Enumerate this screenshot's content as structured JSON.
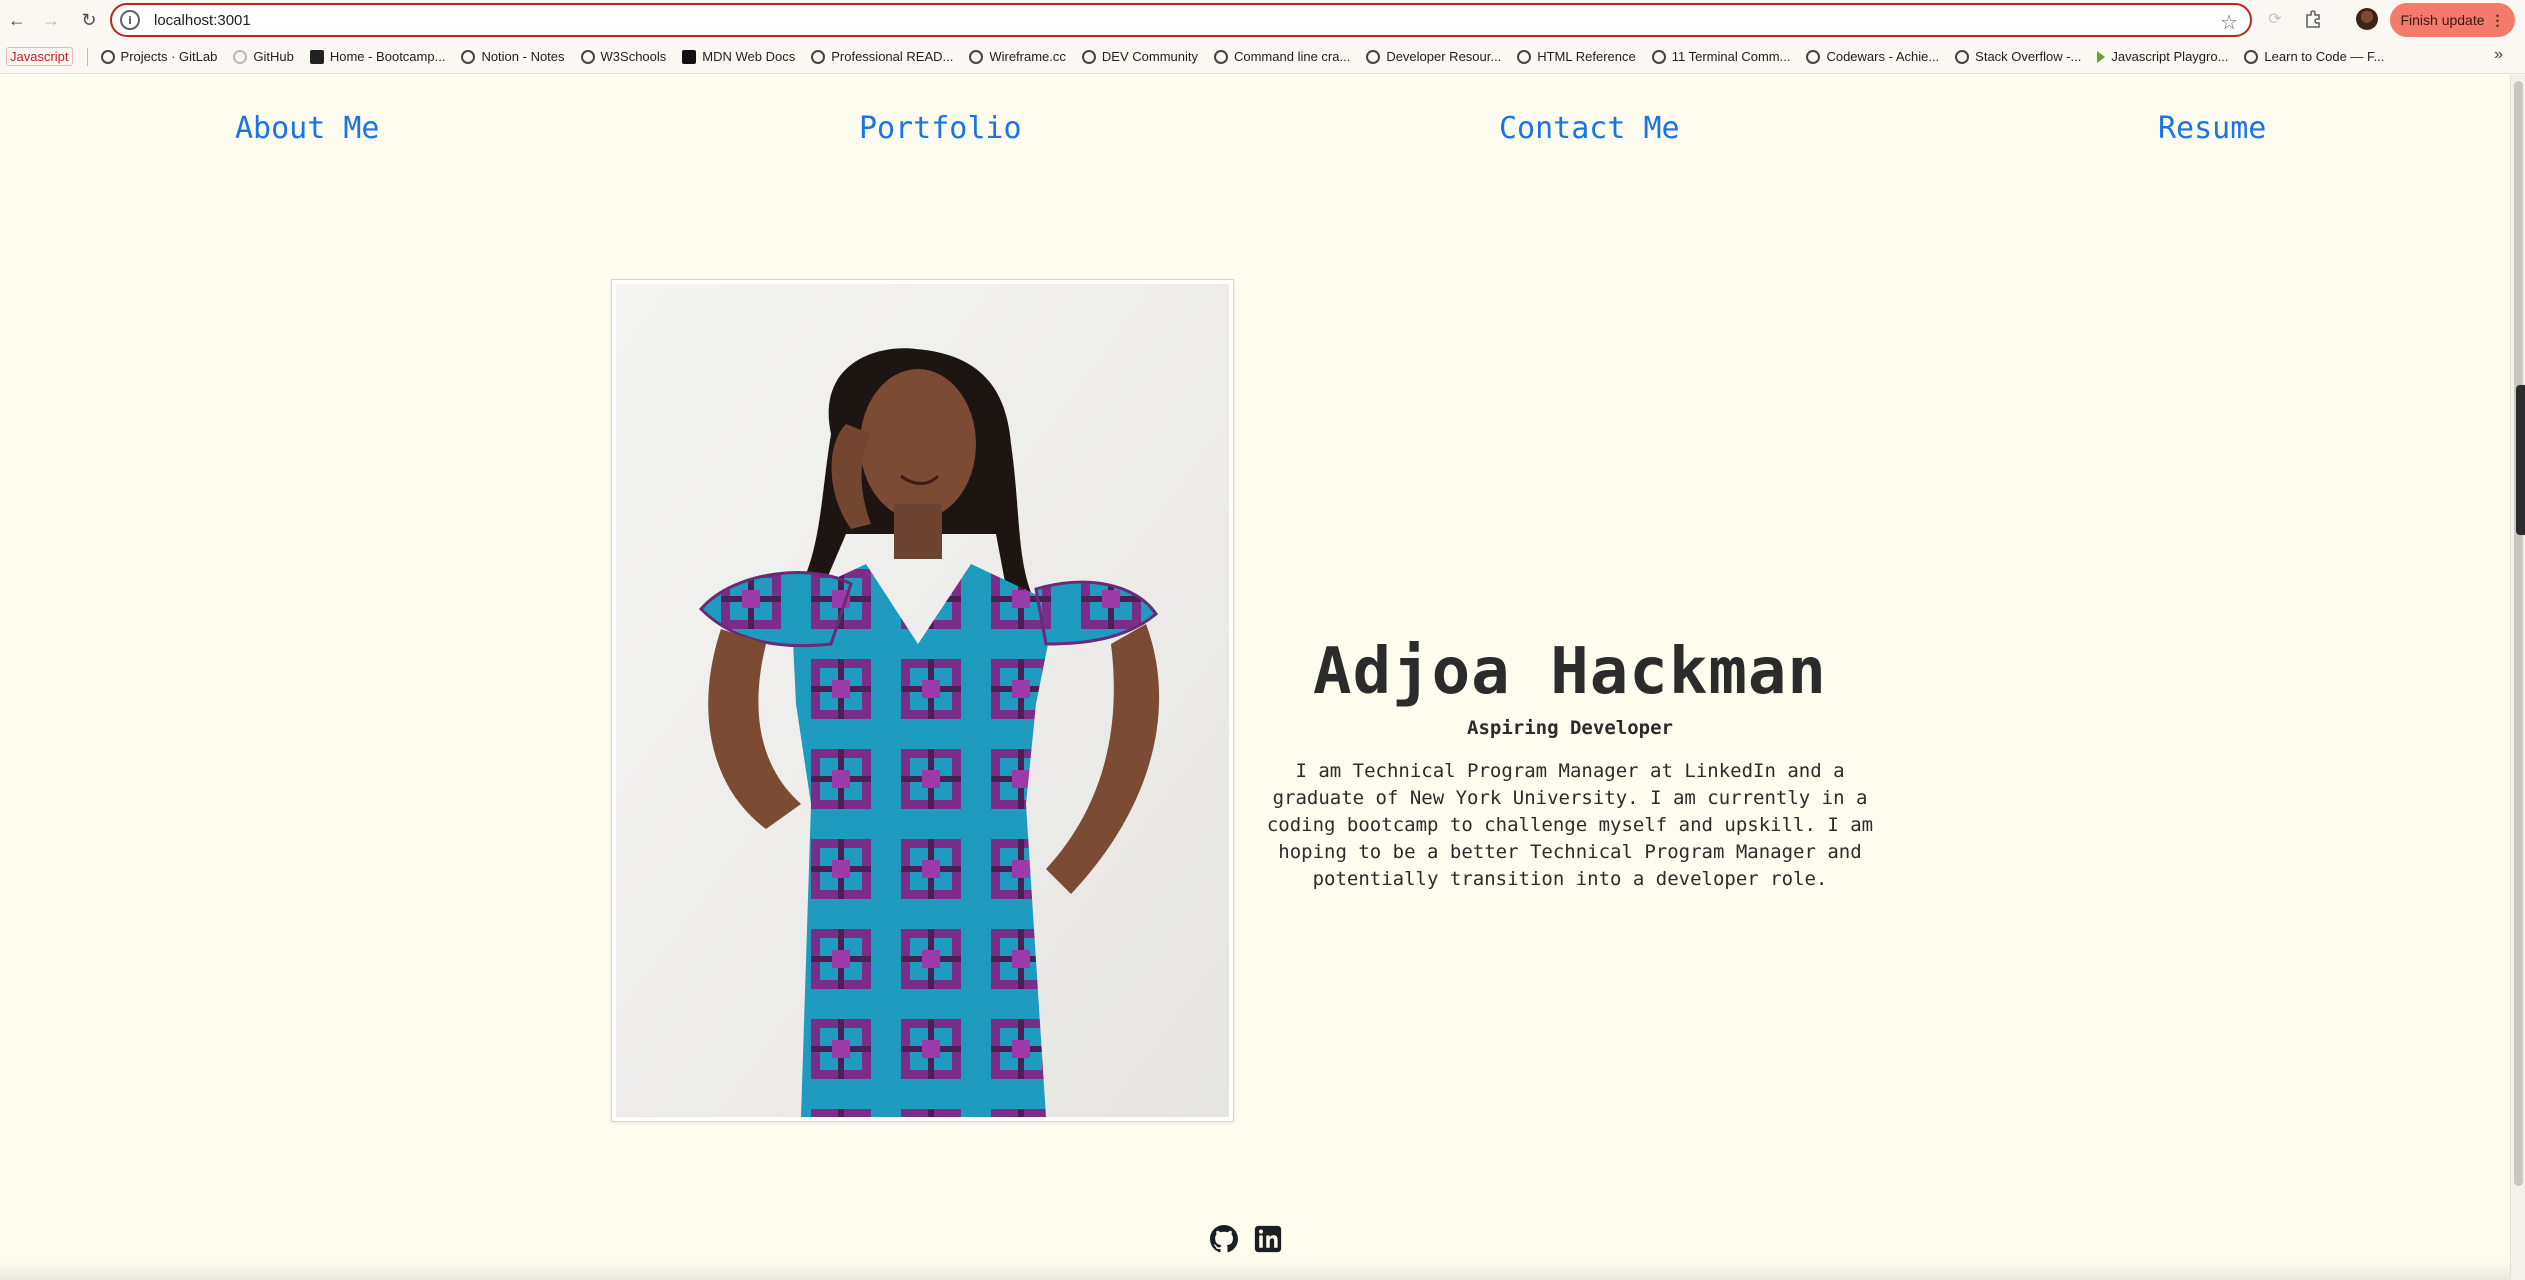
{
  "browser": {
    "url": "localhost:3001",
    "update_label": "Finish update",
    "bookmarks": [
      {
        "label": "Projects · GitLab",
        "icon": "globe-icon"
      },
      {
        "label": "GitHub",
        "icon": "github-icon"
      },
      {
        "label": "Home - Bootcamp...",
        "icon": "bootcamp-icon"
      },
      {
        "label": "Notion - Notes",
        "icon": "globe-icon"
      },
      {
        "label": "W3Schools",
        "icon": "globe-icon"
      },
      {
        "label": "MDN Web Docs",
        "icon": "mdn-icon"
      },
      {
        "label": "Professional READ...",
        "icon": "globe-icon"
      },
      {
        "label": "Wireframe.cc",
        "icon": "globe-icon"
      },
      {
        "label": "DEV Community",
        "icon": "globe-icon"
      },
      {
        "label": "Command line cra...",
        "icon": "globe-icon"
      },
      {
        "label": "Developer Resour...",
        "icon": "globe-icon"
      },
      {
        "label": "HTML Reference",
        "icon": "globe-icon"
      },
      {
        "label": "11 Terminal Comm...",
        "icon": "globe-icon"
      },
      {
        "label": "Codewars - Achie...",
        "icon": "globe-icon"
      },
      {
        "label": "Stack Overflow -...",
        "icon": "globe-icon"
      },
      {
        "label": "Javascript Playgro...",
        "icon": "play-icon"
      },
      {
        "label": "Learn to Code — F...",
        "icon": "globe-icon"
      }
    ],
    "bookmark_folder_label": "Javascript"
  },
  "nav": {
    "about": "About Me",
    "portfolio": "Portfolio",
    "contact": "Contact Me",
    "resume": "Resume"
  },
  "profile": {
    "name": "Adjoa Hackman",
    "tagline": "Aspiring Developer",
    "bio": "I am Technical Program Manager at LinkedIn and a graduate of New York University. I am currently in a coding bootcamp to challenge myself and upskill. I am hoping to be a better Technical Program Manager and potentially transition into a developer role."
  },
  "socials": [
    {
      "icon": "github-icon"
    },
    {
      "icon": "linkedin-icon"
    }
  ],
  "colors": {
    "page_bg": "#fefcef",
    "link": "#1a73e8",
    "text": "#2b2b2b",
    "update_button": "#f47a6b"
  }
}
